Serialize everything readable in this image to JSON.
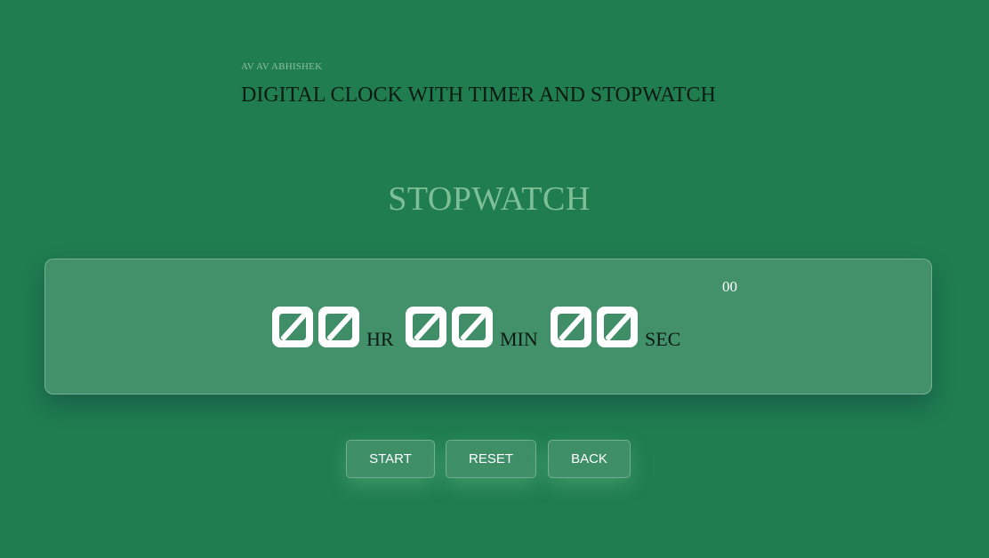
{
  "header": {
    "author": "AV AV ABHISHEK",
    "title": "DIGITAL CLOCK WITH TIMER AND STOPWATCH"
  },
  "stopwatch": {
    "title": "STOPWATCH",
    "milliseconds": "00",
    "hours": "00",
    "hours_unit": "HR",
    "minutes": "00",
    "minutes_unit": "MIN",
    "seconds": "00",
    "seconds_unit": "SEC"
  },
  "controls": {
    "start_label": "START",
    "reset_label": "RESET",
    "back_label": "BACK"
  },
  "colors": {
    "background": "#1f7d4f",
    "heading_accent": "#7fbf97",
    "digit_fill": "#ffffff"
  }
}
